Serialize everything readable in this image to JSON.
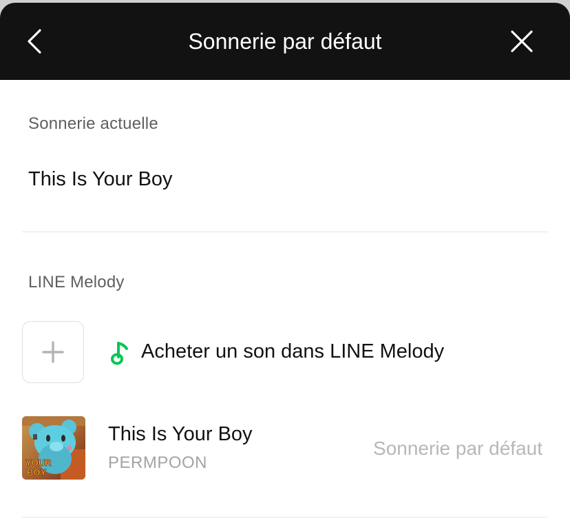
{
  "header": {
    "title": "Sonnerie par défaut",
    "back_icon": "chevron-left-icon",
    "close_icon": "close-icon"
  },
  "current_section": {
    "label": "Sonnerie actuelle",
    "value": "This Is Your Boy"
  },
  "melody_section": {
    "label": "LINE Melody",
    "buy": {
      "label": "Acheter un son dans LINE Melody",
      "icon": "music-note-icon",
      "icon_color": "#06C755"
    },
    "songs": [
      {
        "title": "This Is Your Boy",
        "artist": "PERMPOON",
        "status": "Sonnerie par défaut",
        "art_text_1": "YOUR",
        "art_text_2": "BOY"
      }
    ]
  },
  "colors": {
    "header_bg": "#121212",
    "accent_green": "#06C755"
  }
}
